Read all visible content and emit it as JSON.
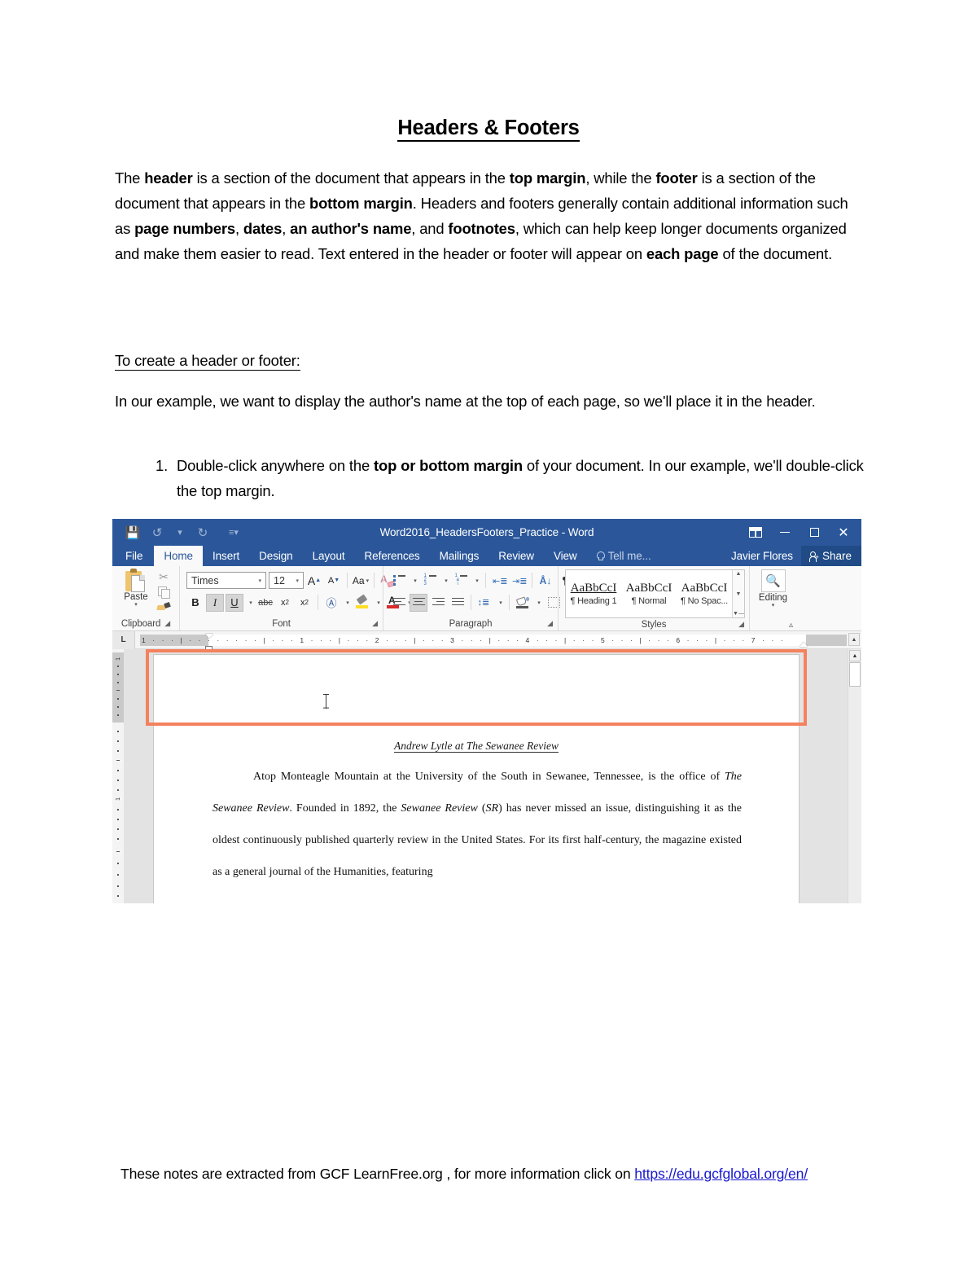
{
  "document": {
    "title": "Headers & Footers",
    "intro_html": "The <b>header</b> is a section of the document that appears in the <b>top margin</b>, while the <b>footer</b> is a section of the document that appears in the <b>bottom margin</b>. Headers and footers generally contain additional information such as <b>page numbers</b>, <b>dates</b>, <b>an author's name</b>, and <b>footnotes</b>, which can help keep longer documents organized and make them easier to read. Text entered in the header or footer will appear on <b>each page</b> of the document.",
    "subheading": "To create a header or footer:",
    "example_text": "In our example, we want to display the author's name at the top of each page, so we'll place it in the header.",
    "steps": [
      "Double-click anywhere on the <b>top or bottom margin</b> of your document. In our example, we'll double-click the top margin."
    ],
    "footer_note_prefix": "These notes are extracted from GCF LearnFree.org , for more information click on ",
    "footer_note_link": "https://edu.gcfglobal.org/en/"
  },
  "word_screenshot": {
    "titlebar": {
      "document_title": "Word2016_HeadersFooters_Practice - Word",
      "quick_access": [
        "save-icon",
        "undo-icon",
        "redo-icon",
        "customize-qat-icon"
      ],
      "window_controls": [
        "ribbon-display-options",
        "minimize",
        "restore",
        "close"
      ]
    },
    "tabs": [
      {
        "label": "File",
        "active": false
      },
      {
        "label": "Home",
        "active": true
      },
      {
        "label": "Insert",
        "active": false
      },
      {
        "label": "Design",
        "active": false
      },
      {
        "label": "Layout",
        "active": false
      },
      {
        "label": "References",
        "active": false
      },
      {
        "label": "Mailings",
        "active": false
      },
      {
        "label": "Review",
        "active": false
      },
      {
        "label": "View",
        "active": false
      }
    ],
    "tell_me": "Tell me...",
    "user_name": "Javier Flores",
    "share_label": "Share",
    "ribbon": {
      "groups": [
        {
          "label": "Clipboard",
          "paste_label": "Paste"
        },
        {
          "label": "Font"
        },
        {
          "label": "Paragraph"
        },
        {
          "label": "Styles"
        },
        {
          "label": "Editing"
        }
      ],
      "font": {
        "font_name": "Times",
        "font_size": "12",
        "change_case_label": "Aa"
      },
      "styles": [
        {
          "sample": "AaBbCcI",
          "name": "¶ Heading 1"
        },
        {
          "sample": "AaBbCcI",
          "name": "¶ Normal"
        },
        {
          "sample": "AaBbCcI",
          "name": "¶ No Spac..."
        }
      ],
      "editing_label": "Editing"
    },
    "ruler": {
      "tabstop_glyph": "L",
      "tick_text": "1 · · · | · · · · ·  · · · | · · · 1 · · · | · · · 2 · · · | · · · 3 · · · | · · · 4 · · · | · · · 5 · · · | · · · 6 · · · | · · · 7 · · ·"
    },
    "canvas": {
      "header_text": "Andrew Lytle at The Sewanee Review",
      "body_lines": [
        "Atop Monteagle Mountain at the University of the South in Sewanee, Tennessee, is the office of <i>The Sewanee Review</i>. Founded in 1892, the <i>Sewanee Review</i> (<i>SR</i>) has never missed an issue, distinguishing it as the oldest continuously published quarterly review in the United States. For its first half-century, the magazine existed as a general journal of the Humanities, featuring"
      ],
      "highlight_color": "#f4825e"
    }
  },
  "colors": {
    "word_blue": "#2b579a",
    "share_blue": "#204b86",
    "highlight_orange": "#f4825e",
    "link_blue": "#1717d0"
  }
}
